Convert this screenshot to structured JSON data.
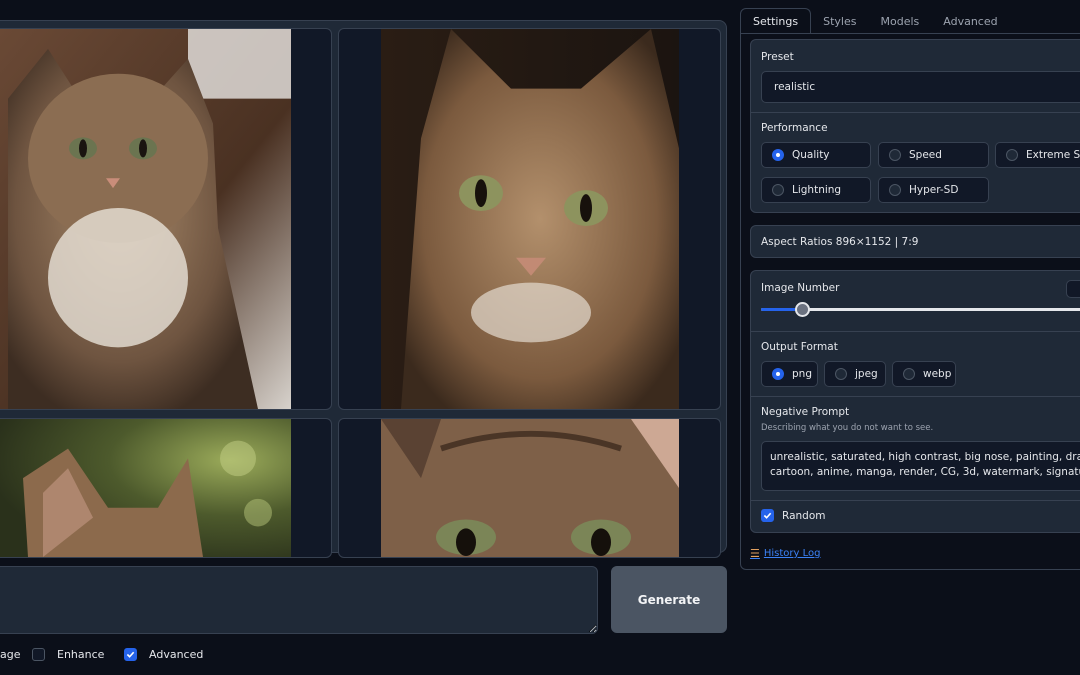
{
  "gallery": {
    "images": [
      {
        "alt": "cat-image-1"
      },
      {
        "alt": "cat-image-2"
      },
      {
        "alt": "cat-image-3"
      },
      {
        "alt": "cat-image-4"
      }
    ]
  },
  "prompt": {
    "value": "",
    "placeholder": ""
  },
  "generate_label": "Generate",
  "options": {
    "image_prompt_label": "age",
    "enhance_label": "Enhance",
    "enhance_checked": false,
    "advanced_label": "Advanced",
    "advanced_checked": true
  },
  "tabs": [
    "Settings",
    "Styles",
    "Models",
    "Advanced"
  ],
  "active_tab": "Settings",
  "settings": {
    "preset_label": "Preset",
    "preset_value": "realistic",
    "performance_label": "Performance",
    "performance_options": [
      "Quality",
      "Speed",
      "Extreme Spe",
      "Lightning",
      "Hyper-SD"
    ],
    "performance_selected": "Quality",
    "aspect_ratios_label": "Aspect Ratios 896×1152 | 7:9",
    "image_number_label": "Image Number",
    "image_number_fraction": 0.12,
    "output_format_label": "Output Format",
    "output_formats": [
      "png",
      "jpeg",
      "webp"
    ],
    "output_format_selected": "png",
    "negative_prompt_label": "Negative Prompt",
    "negative_prompt_hint": "Describing what you do not want to see.",
    "negative_prompt_line1": "unrealistic, saturated, high contrast, big nose, painting, drawing, ske",
    "negative_prompt_line2": "cartoon, anime, manga, render, CG, 3d, watermark, signature, label",
    "random_label": "Random",
    "random_checked": true
  },
  "history_label": "History Log",
  "colors": {
    "accent": "#2563eb",
    "link": "#3b82f6",
    "background": "#0b0f19",
    "card": "#1f2937"
  }
}
